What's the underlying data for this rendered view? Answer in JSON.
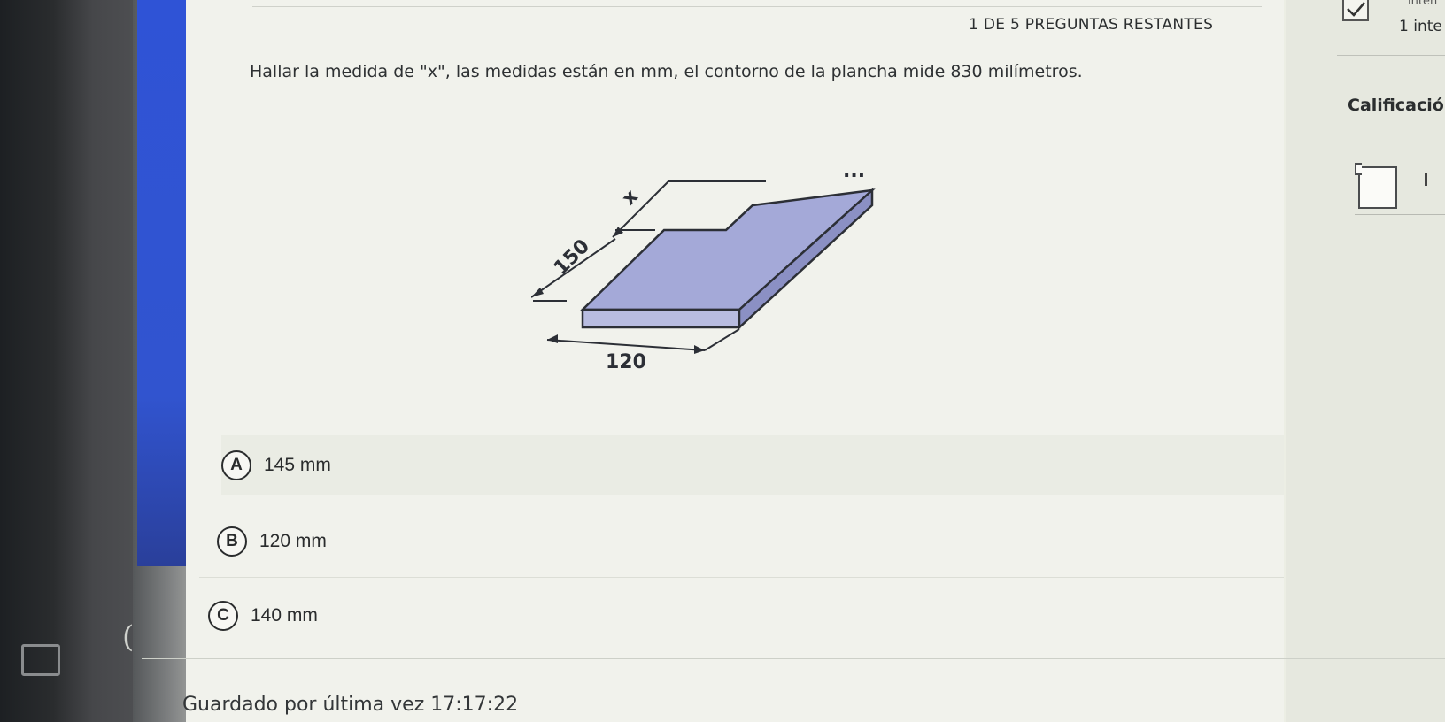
{
  "header": {
    "remaining": "1 DE 5 PREGUNTAS RESTANTES"
  },
  "sidebar_right": {
    "attempts_top": "inten",
    "attempts": "1 inte",
    "grade_label": "Calificació"
  },
  "question": {
    "text": "Hallar la medida de \"x\", las medidas están en mm, el contorno de la plancha mide 830 milímetros."
  },
  "diagram": {
    "label_x": "x",
    "label_150": "150",
    "label_120": "120",
    "more_menu": "..."
  },
  "options": [
    {
      "letter": "A",
      "text": "145 mm"
    },
    {
      "letter": "B",
      "text": "120 mm"
    },
    {
      "letter": "C",
      "text": "140 mm"
    }
  ],
  "footer": {
    "saved": "Guardado por última vez 17:17:22"
  },
  "bezel": {
    "glyph": "("
  },
  "colors": {
    "accent": "#2f53d6",
    "plate_fill": "#a4a9d8",
    "plate_edge": "#2c2f36"
  }
}
